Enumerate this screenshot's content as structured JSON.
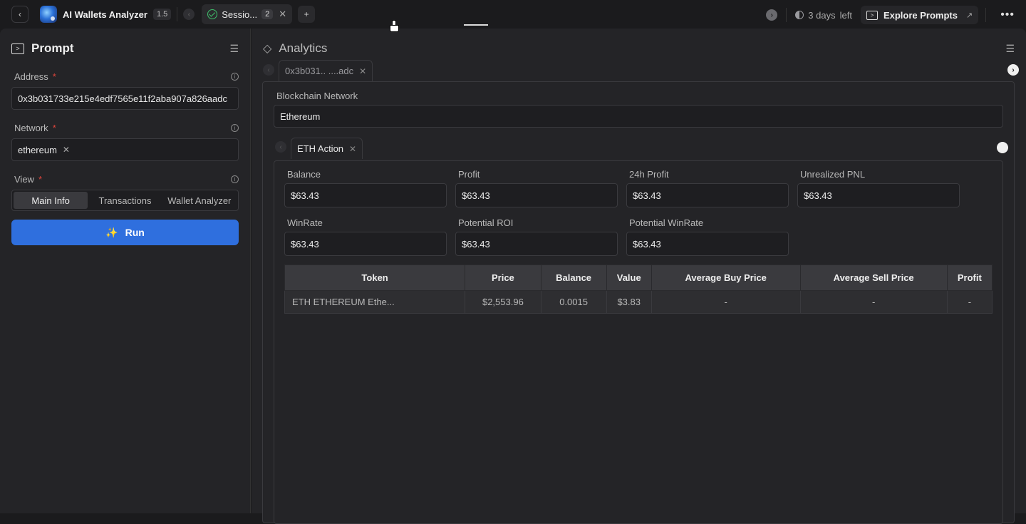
{
  "topbar": {
    "app_title": "AI Wallets Analyzer",
    "version": "1.5",
    "session_label": "Sessio...",
    "session_count": "2",
    "days_left_num": "3 days",
    "days_left_word": "left",
    "explore_label": "Explore Prompts"
  },
  "prompt": {
    "title": "Prompt",
    "address_label": "Address",
    "address_value": "0x3b031733e215e4edf7565e11f2aba907a826aadc",
    "network_label": "Network",
    "network_chip": "ethereum",
    "view_label": "View",
    "view_options": [
      "Main Info",
      "Transactions",
      "Wallet Analyzer"
    ],
    "run_label": "Run"
  },
  "analytics": {
    "title": "Analytics",
    "result_tab": "0x3b031.. ....adc",
    "network_label": "Blockchain Network",
    "network_value": "Ethereum",
    "action_tab": "ETH Action",
    "stats": [
      {
        "label": "Balance",
        "value": "$63.43"
      },
      {
        "label": "Profit",
        "value": "$63.43"
      },
      {
        "label": "24h Profit",
        "value": "$63.43"
      },
      {
        "label": "Unrealized PNL",
        "value": "$63.43"
      },
      {
        "label": "WinRate",
        "value": "$63.43"
      },
      {
        "label": "Potential ROI",
        "value": "$63.43"
      },
      {
        "label": "Potential WinRate",
        "value": "$63.43"
      }
    ],
    "table": {
      "headers": [
        "Token",
        "Price",
        "Balance",
        "Value",
        "Average Buy Price",
        "Average Sell Price",
        "Profit"
      ],
      "rows": [
        [
          "ETH ETHEREUM Ethe...",
          "$2,553.96",
          "0.0015",
          "$3.83",
          "-",
          "-",
          "-"
        ]
      ]
    }
  }
}
